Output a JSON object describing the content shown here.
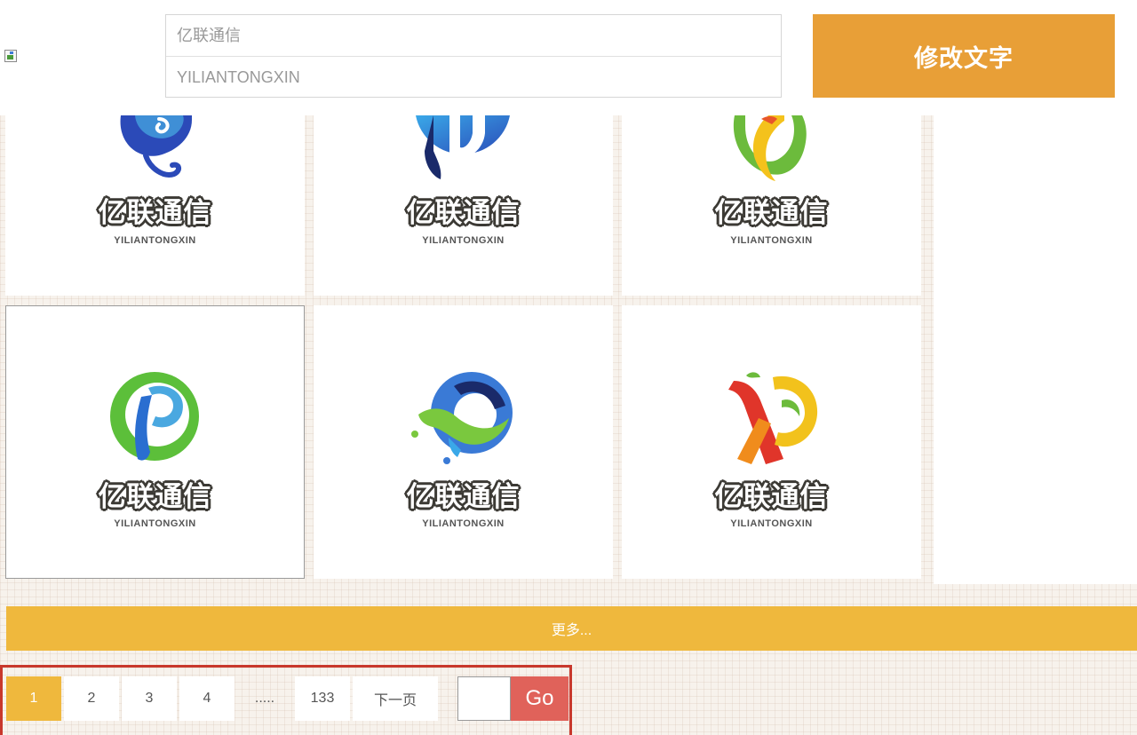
{
  "header": {
    "name_input": {
      "placeholder": "亿联通信"
    },
    "pinyin_input": {
      "placeholder": "YILIANTONGXIN"
    },
    "edit_button_label": "修改文字"
  },
  "logos": [
    {
      "cn": "亿联通信",
      "en": "YILIANTONGXIN",
      "icon": "blue-swirl-p-logo-icon"
    },
    {
      "cn": "亿联通信",
      "en": "YILIANTONGXIN",
      "icon": "blue-circle-d-logo-icon"
    },
    {
      "cn": "亿联通信",
      "en": "YILIANTONGXIN",
      "icon": "green-yellow-c-logo-icon"
    },
    {
      "cn": "亿联通信",
      "en": "YILIANTONGXIN",
      "icon": "green-blue-p-logo-icon"
    },
    {
      "cn": "亿联通信",
      "en": "YILIANTONGXIN",
      "icon": "blue-green-q-logo-icon"
    },
    {
      "cn": "亿联通信",
      "en": "YILIANTONGXIN",
      "icon": "red-yellow-xd-logo-icon"
    }
  ],
  "more_label": "更多...",
  "pagination": {
    "pages": [
      "1",
      "2",
      "3",
      "4"
    ],
    "ellipsis": ".....",
    "last_page": "133",
    "next_label": "下一页",
    "go_label": "Go",
    "current": "1"
  },
  "colors": {
    "accent_orange": "#e89f37",
    "more_yellow": "#efb83d",
    "go_red": "#e0625a",
    "pager_border": "#c8382c"
  }
}
